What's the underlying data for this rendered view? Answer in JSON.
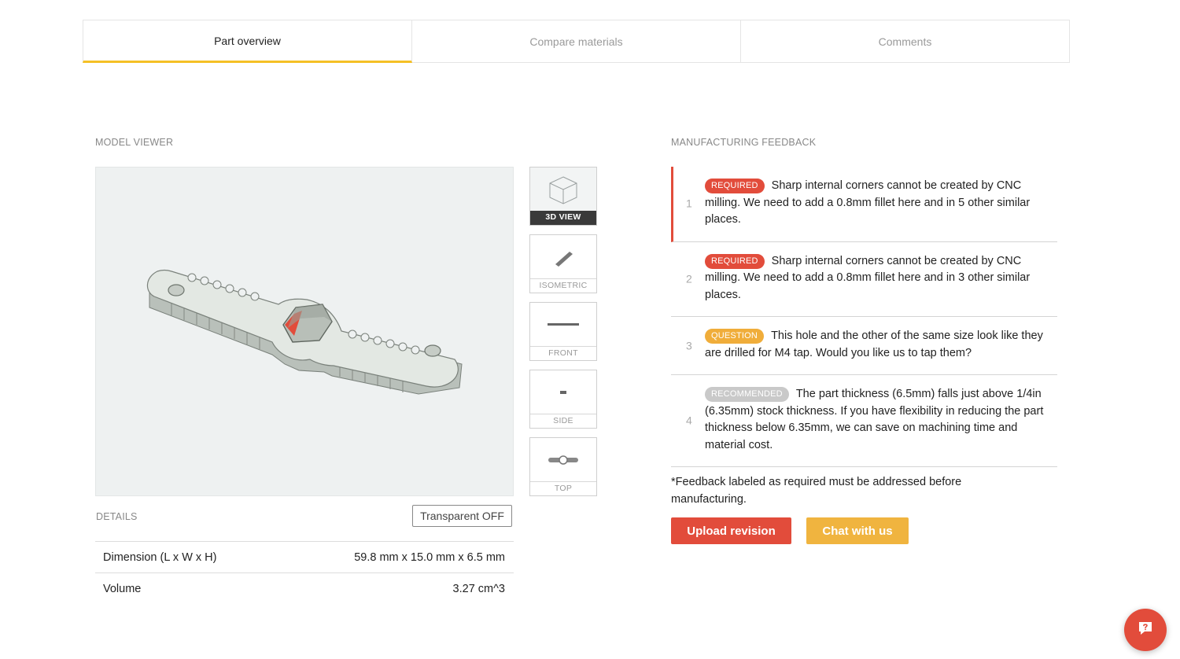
{
  "tabs": [
    {
      "label": "Part overview",
      "active": true
    },
    {
      "label": "Compare materials",
      "active": false
    },
    {
      "label": "Comments",
      "active": false
    }
  ],
  "model_viewer": {
    "heading": "MODEL VIEWER",
    "views": [
      {
        "label": "3D VIEW",
        "active": true
      },
      {
        "label": "ISOMETRIC",
        "active": false
      },
      {
        "label": "FRONT",
        "active": false
      },
      {
        "label": "SIDE",
        "active": false
      },
      {
        "label": "TOP",
        "active": false
      }
    ]
  },
  "details": {
    "heading": "DETAILS",
    "transparent_button": "Transparent OFF",
    "rows": [
      {
        "label": "Dimension (L x W x H)",
        "value": "59.8 mm x 15.0 mm x 6.5 mm"
      },
      {
        "label": "Volume",
        "value": "3.27 cm^3"
      }
    ]
  },
  "feedback": {
    "heading": "MANUFACTURING FEEDBACK",
    "items": [
      {
        "num": "1",
        "badge": "REQUIRED",
        "type": "required",
        "text": "Sharp internal corners cannot be created by CNC milling. We need to add a 0.8mm fillet here and in 5 other similar places."
      },
      {
        "num": "2",
        "badge": "REQUIRED",
        "type": "required",
        "text": "Sharp internal corners cannot be created by CNC milling. We need to add a 0.8mm fillet here and in 3 other similar places."
      },
      {
        "num": "3",
        "badge": "QUESTION",
        "type": "question",
        "text": "This hole and the other of the same size look like they are drilled for M4 tap. Would you like us to tap them?"
      },
      {
        "num": "4",
        "badge": "RECOMMENDED",
        "type": "recommended",
        "text": "The part thickness (6.5mm) falls just above 1/4in (6.35mm) stock thickness. If you have flexibility in reducing the part thickness below 6.35mm, we can save on machining time and material cost."
      }
    ],
    "footnote": "*Feedback labeled as required must be addressed before manufacturing.",
    "upload_button": "Upload revision",
    "chat_button": "Chat with us"
  },
  "colors": {
    "accent_red": "#e24c3b",
    "accent_yellow": "#f0b43f",
    "tab_underline": "#f5c026",
    "part_fill": "#e3e8e3"
  },
  "icons": {
    "chat_fab": "chat-bubble-icon"
  }
}
